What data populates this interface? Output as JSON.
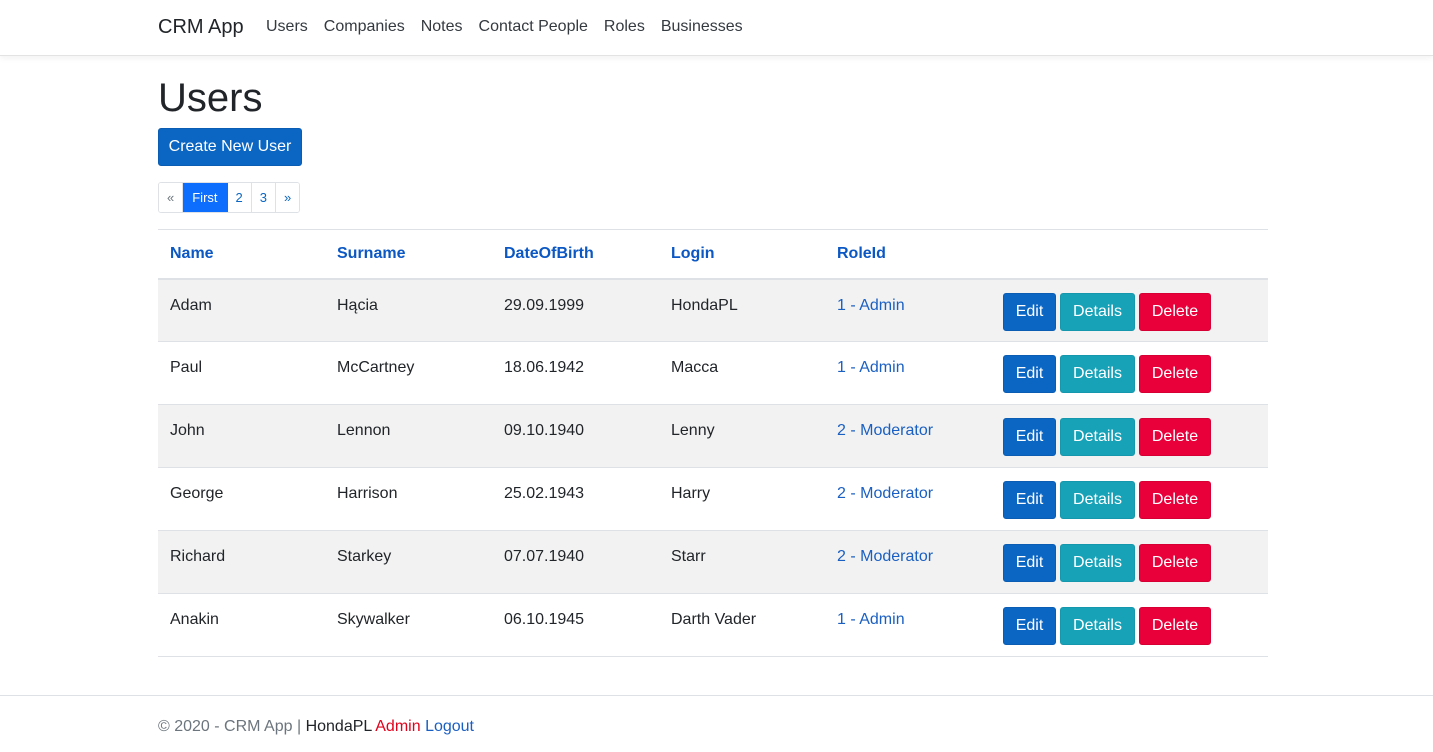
{
  "navbar": {
    "brand": "CRM App",
    "links": [
      "Users",
      "Companies",
      "Notes",
      "Contact People",
      "Roles",
      "Businesses"
    ]
  },
  "page": {
    "title": "Users",
    "create_button": "Create New User"
  },
  "pagination": {
    "prev": "«",
    "pages": [
      "First",
      "2",
      "3"
    ],
    "active_page": "First",
    "next": "»"
  },
  "table": {
    "columns": [
      "Name",
      "Surname",
      "DateOfBirth",
      "Login",
      "RoleId"
    ],
    "rows": [
      {
        "name": "Adam",
        "surname": "Hącia",
        "dob": "29.09.1999",
        "login": "HondaPL",
        "role": "1 - Admin"
      },
      {
        "name": "Paul",
        "surname": "McCartney",
        "dob": "18.06.1942",
        "login": "Macca",
        "role": "1 - Admin"
      },
      {
        "name": "John",
        "surname": "Lennon",
        "dob": "09.10.1940",
        "login": "Lenny",
        "role": "2 - Moderator"
      },
      {
        "name": "George",
        "surname": "Harrison",
        "dob": "25.02.1943",
        "login": "Harry",
        "role": "2 - Moderator"
      },
      {
        "name": "Richard",
        "surname": "Starkey",
        "dob": "07.07.1940",
        "login": "Starr",
        "role": "2 - Moderator"
      },
      {
        "name": "Anakin",
        "surname": "Skywalker",
        "dob": "06.10.1945",
        "login": "Darth Vader",
        "role": "1 - Admin"
      }
    ],
    "actions": {
      "edit": "Edit",
      "details": "Details",
      "delete": "Delete"
    }
  },
  "footer": {
    "copyright": "© 2020 - CRM App | ",
    "user": "HondaPL",
    "role": "Admin",
    "logout": "Logout"
  },
  "colors": {
    "primary": "#0b66c3",
    "info": "#17a2b8",
    "danger": "#e9003a",
    "link": "#1a5fc2",
    "header_link": "#0b57c3"
  }
}
